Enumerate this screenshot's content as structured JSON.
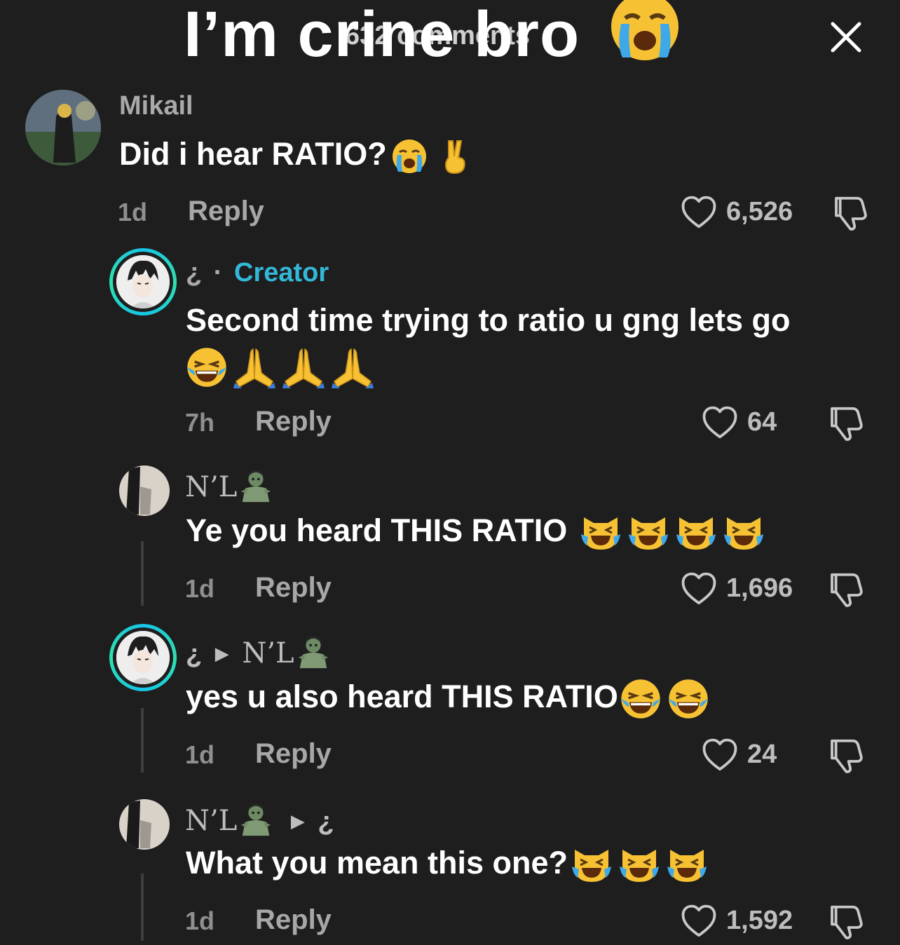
{
  "header": {
    "overlay_caption": "I’m crine bro",
    "comments_count": "632 comments"
  },
  "comments": [
    {
      "username": "Mikail",
      "text": "Did i hear RATIO?",
      "time": "1d",
      "reply_label": "Reply",
      "likes": "6,526",
      "emojis": [
        "loudly-crying-face",
        "victory-hand"
      ]
    },
    {
      "username": "¿",
      "separator": "·",
      "creator_label": "Creator",
      "text": "Second time trying to ratio u gng lets go",
      "time": "7h",
      "reply_label": "Reply",
      "likes": "64",
      "emojis": [
        "face-with-tears-of-joy",
        "folded-hands",
        "folded-hands",
        "folded-hands"
      ]
    },
    {
      "username": "N’L",
      "text": "Ye you heard THIS RATIO",
      "time": "1d",
      "reply_label": "Reply",
      "likes": "1,696",
      "emojis": [
        "zombie",
        "cat-with-tears-of-joy",
        "cat-with-tears-of-joy",
        "cat-with-tears-of-joy",
        "cat-with-tears-of-joy"
      ]
    },
    {
      "username": "¿",
      "reply_to": "N’L",
      "text": "yes u also heard THIS RATIO",
      "time": "1d",
      "reply_label": "Reply",
      "likes": "24",
      "emojis": [
        "zombie",
        "face-with-tears-of-joy",
        "face-with-tears-of-joy"
      ]
    },
    {
      "username": "N’L",
      "reply_to": "¿",
      "text": "What you mean this one?",
      "time": "1d",
      "reply_label": "Reply",
      "likes": "1,592",
      "emojis": [
        "zombie",
        "cat-with-tears-of-joy",
        "cat-with-tears-of-joy",
        "cat-with-tears-of-joy"
      ]
    }
  ],
  "colors": {
    "background": "#1e1e1e",
    "creator_accent": "#33b8d9",
    "text_primary": "#ffffff",
    "text_secondary": "#a9a9a9"
  }
}
